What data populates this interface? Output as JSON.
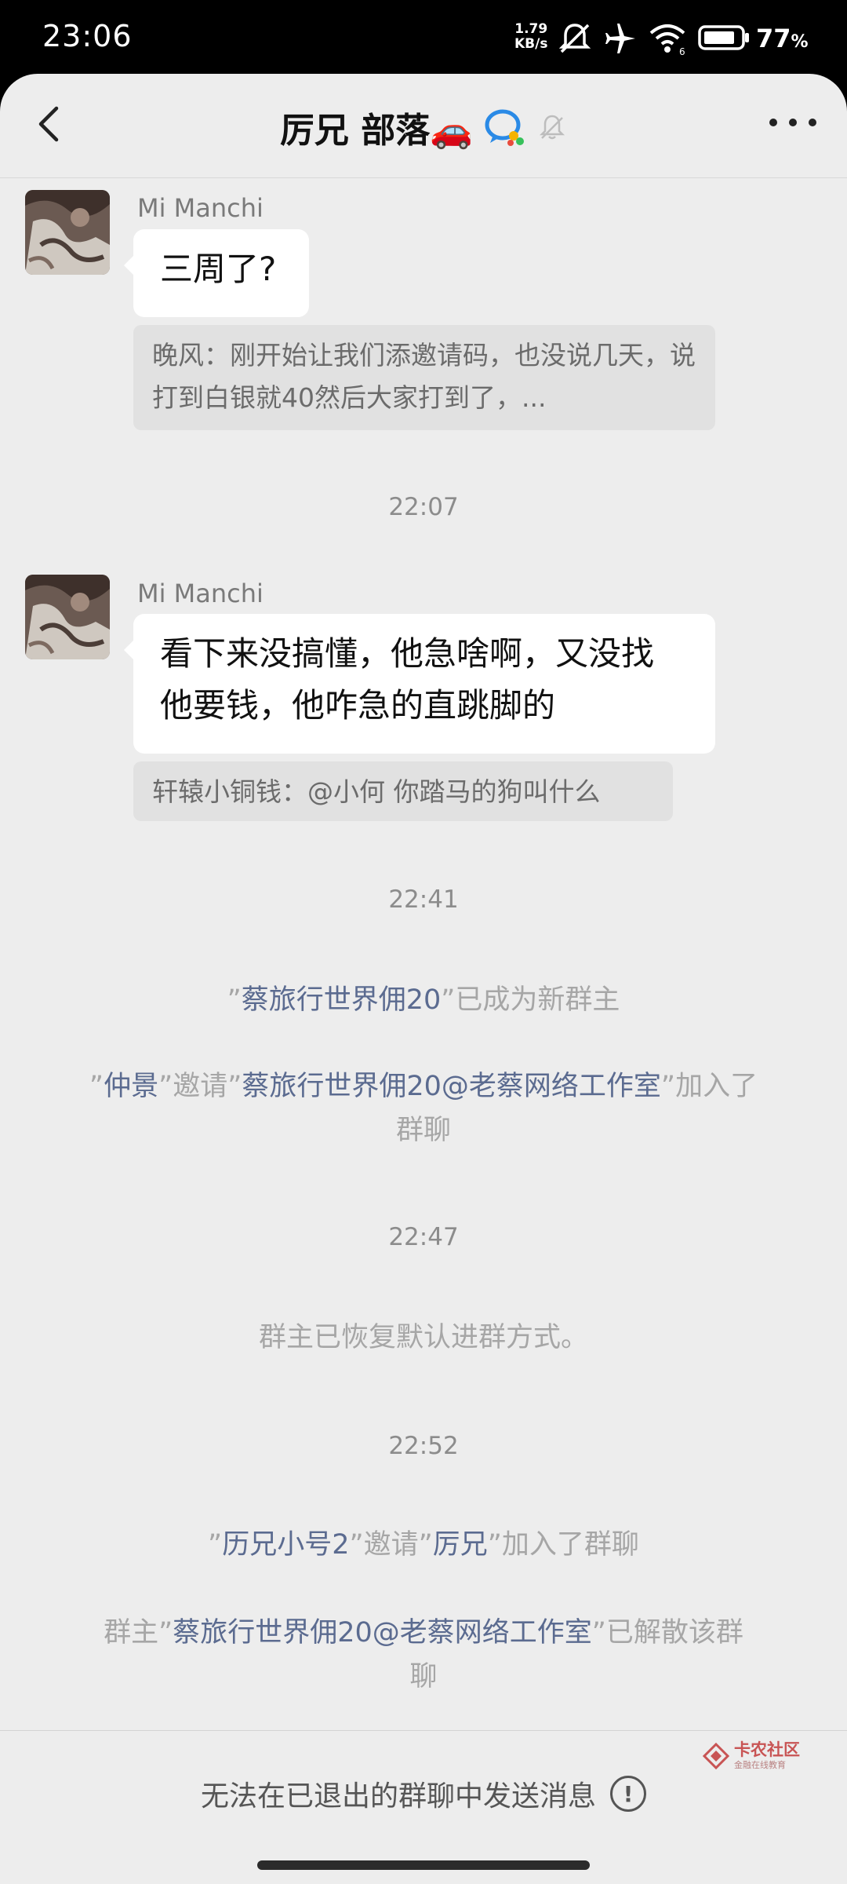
{
  "status_bar": {
    "time": "23:06",
    "net_speed_value": "1.79",
    "net_speed_unit": "KB/s",
    "battery_percent": "77",
    "battery_unit": "%",
    "icons": [
      "mute-vibrate-icon",
      "airplane-icon",
      "wifi-icon",
      "battery-icon"
    ]
  },
  "header": {
    "title": "厉兄 部落🚗",
    "back_icon": "chevron-left-icon",
    "more_icon": "more-dots-icon",
    "group_icon": "group-chat-icon",
    "mute_icon": "bell-muted-icon"
  },
  "messages": [
    {
      "sender": "Mi Manchi",
      "text": "三周了?",
      "quote": "晚风：刚开始让我们添邀请码，也没说几天，说打到白银就40然后大家打到了，..."
    },
    {
      "sender": "Mi Manchi",
      "text_lines": [
        "看下来没搞懂，他急啥啊，又没找",
        "他要钱，他咋急的直跳脚的"
      ],
      "quote": "轩辕小铜钱：@小何 你踏马的狗叫什么"
    }
  ],
  "timestamps": [
    "22:07",
    "22:41",
    "22:47",
    "22:52"
  ],
  "system": {
    "new_owner": {
      "q1": "”",
      "name": "蔡旅行世界佣20",
      "q2": "”",
      "tail": "已成为新群主"
    },
    "invite1": {
      "q1": "”",
      "inviter": "仲景",
      "q2": "”",
      "mid": "邀请",
      "q3": "”",
      "invitee": "蔡旅行世界佣20@老蔡网络工作室",
      "q4": "”",
      "tail": "加入了",
      "tail2": "群聊"
    },
    "restore": "群主已恢复默认进群方式。",
    "invite2": {
      "q1": "”",
      "inviter": "历兄小号2",
      "q2": "”",
      "mid": "邀请",
      "q3": "”",
      "invitee": "厉兄",
      "q4": "”",
      "tail": "加入了群聊"
    },
    "dissolve": {
      "head": "群主",
      "q1": "”",
      "name": "蔡旅行世界佣20@老蔡网络工作室",
      "q2": "”",
      "tail": "已解散该群",
      "tail2": "聊"
    }
  },
  "footer": {
    "text": "无法在已退出的群聊中发送消息",
    "icon": "exclamation-circle-icon"
  },
  "watermark": {
    "title": "卡农社区",
    "subtitle": "金融在线教育"
  },
  "colors": {
    "background": "#ededed",
    "bubble": "#ffffff",
    "quote": "#e1e1e1",
    "highlight": "#5b6b90",
    "system_text": "#a6a6a6"
  }
}
